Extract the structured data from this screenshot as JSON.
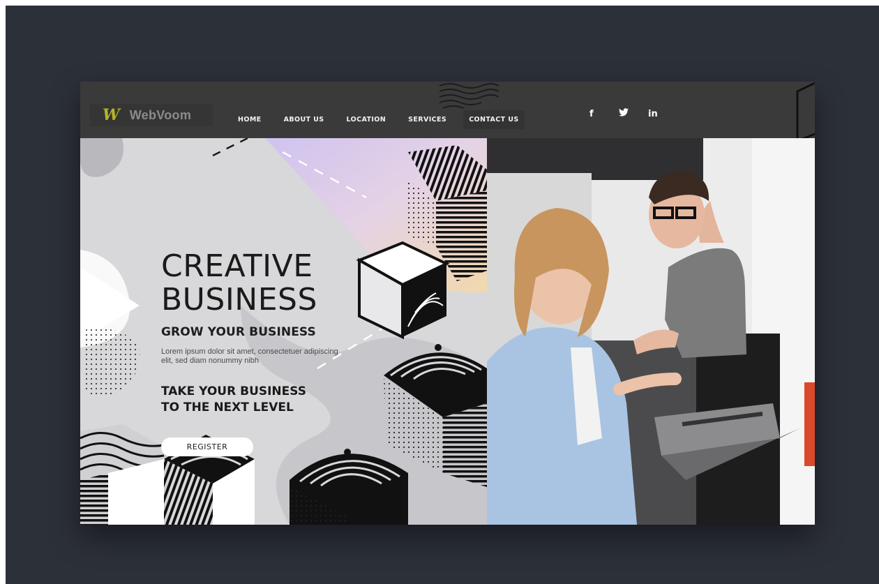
{
  "brand": {
    "logo_mark": "W",
    "name": "WebVoom"
  },
  "nav": {
    "items": [
      "HOME",
      "ABOUT US",
      "LOCATION",
      "SERVICES",
      "CONTACT US"
    ]
  },
  "socials": {
    "facebook": "f",
    "twitter": "🐦",
    "linkedin": "in"
  },
  "hero": {
    "headline_line1": "CREATIVE",
    "headline_line2": "BUSINESS",
    "subhead": "GROW YOUR BUSINESS",
    "lorem": "Lorem ipsum dolor sit amet, consectetuer adipiscing elit, sed diam nonummy nibh",
    "tagline_line1": "TAKE YOUR BUSINESS",
    "tagline_line2": "TO THE NEXT LEVEL",
    "cta_label": "REGISTER"
  },
  "colors": {
    "backdrop": "#2c3039",
    "navbar": "#3a3a3a",
    "logo_accent": "#b5b32a",
    "hero_bg": "#d8d8da"
  }
}
